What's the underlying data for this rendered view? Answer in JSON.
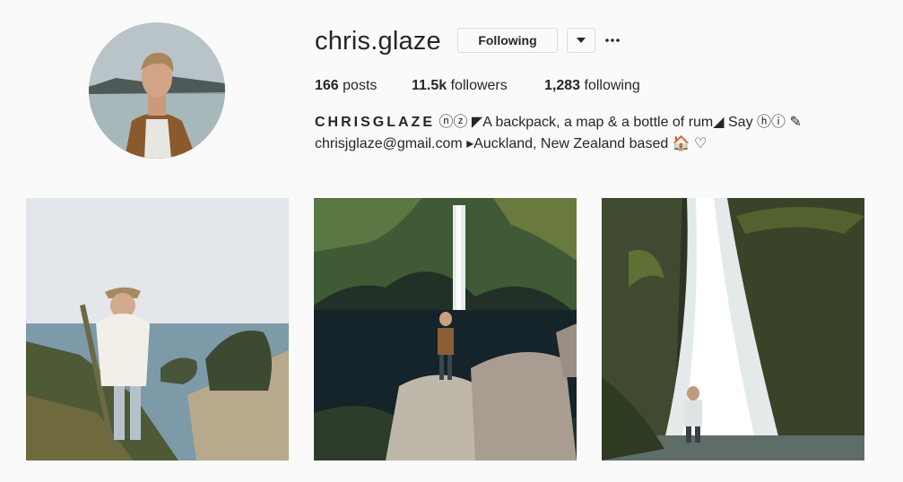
{
  "profile": {
    "username": "chris.glaze",
    "follow_button_label": "Following",
    "dropdown_icon": "chevron-down-icon",
    "more_icon": "more-options-icon"
  },
  "stats": {
    "posts_count": "166",
    "posts_label": "posts",
    "followers_count": "11.5k",
    "followers_label": "followers",
    "following_count": "1,283",
    "following_label": "following"
  },
  "bio": {
    "name": "CHRISGLAZE",
    "name_emoji": "ⓝⓩ",
    "line1_text": "◤A backpack, a map & a bottle of rum◢ Say ⓗⓘ ✎",
    "email": "chrisjglaze@gmail.com",
    "line2_text": " ▸Auckland, New Zealand based 🏠 ♡"
  },
  "posts": [
    {
      "scene": "coastal-cliff-photo"
    },
    {
      "scene": "waterfall-pool-photo"
    },
    {
      "scene": "jungle-waterfall-photo"
    }
  ],
  "colors": {
    "text": "#262626",
    "background": "#fafafa",
    "border": "#dbdbdb"
  }
}
